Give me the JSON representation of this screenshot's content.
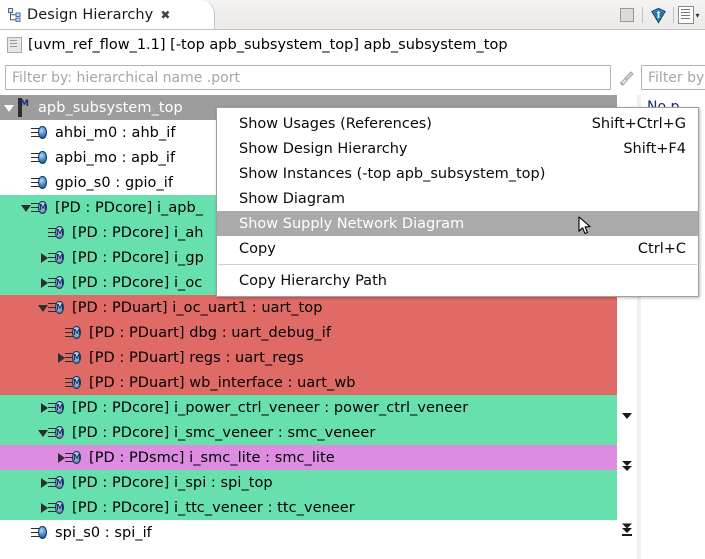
{
  "window": {
    "tab": {
      "label": "Design Hierarchy",
      "close": "✖",
      "icon": "hierarchy-icon"
    },
    "toolbar": [
      {
        "name": "minimize-button",
        "icon": "square-icon"
      },
      {
        "name": "debug-button",
        "icon": "bug-shield-icon"
      },
      {
        "name": "view-menu-button",
        "icon": "list-icon"
      }
    ],
    "view_menu_chevron": "▾"
  },
  "breadcrumb": {
    "icon": "design-icon",
    "text": "[uvm_ref_flow_1.1] [-top apb_subsystem_top] apb_subsystem_top"
  },
  "filter": {
    "placeholder": "Filter by: hierarchical name .port",
    "value": "",
    "clear_icon": "broom-icon",
    "secondary": {
      "placeholder": "Filter by",
      "value": ""
    }
  },
  "right_pane": {
    "text": "No p"
  },
  "nav_strip": [
    {
      "name": "scroll-down-button",
      "icon": "chevron-down-icon"
    },
    {
      "name": "scroll-page-down-button",
      "icon": "double-chevron-down-icon"
    },
    {
      "name": "scroll-to-end-button",
      "icon": "chevron-down-to-bar-icon"
    }
  ],
  "tree": {
    "rows": [
      {
        "indent": 0,
        "arrow": "open",
        "icon": "module-icon",
        "label": "apb_subsystem_top",
        "bg": "sel"
      },
      {
        "indent": 1,
        "arrow": "none",
        "icon": "interface-icon",
        "label": "ahbi_m0 : ahb_if",
        "bg": "white"
      },
      {
        "indent": 1,
        "arrow": "none",
        "icon": "interface-icon",
        "label": "apbi_mo : apb_if",
        "bg": "white"
      },
      {
        "indent": 1,
        "arrow": "none",
        "icon": "interface-icon",
        "label": "gpio_s0 : gpio_if",
        "bg": "white"
      },
      {
        "indent": 1,
        "arrow": "open",
        "icon": "pd-module-icon",
        "label": "[PD : PDcore] i_apb_",
        "bg": "green"
      },
      {
        "indent": 2,
        "arrow": "none",
        "icon": "pd-module-icon",
        "label": "[PD : PDcore] i_ah",
        "bg": "green"
      },
      {
        "indent": 2,
        "arrow": "closed",
        "icon": "pd-module-icon",
        "label": "[PD : PDcore] i_gp",
        "bg": "green"
      },
      {
        "indent": 2,
        "arrow": "closed",
        "icon": "pd-module-icon",
        "label": "[PD : PDcore] i_oc",
        "bg": "green"
      },
      {
        "indent": 2,
        "arrow": "open",
        "icon": "pd-module-icon",
        "label": "[PD : PDuart] i_oc_uart1 : uart_top",
        "bg": "red"
      },
      {
        "indent": 3,
        "arrow": "none",
        "icon": "pd-module-icon",
        "label": "[PD : PDuart] dbg : uart_debug_if",
        "bg": "red"
      },
      {
        "indent": 3,
        "arrow": "closed",
        "icon": "pd-module-icon",
        "label": "[PD : PDuart] regs : uart_regs",
        "bg": "red"
      },
      {
        "indent": 3,
        "arrow": "none",
        "icon": "pd-module-icon",
        "label": "[PD : PDuart] wb_interface : uart_wb",
        "bg": "red"
      },
      {
        "indent": 2,
        "arrow": "closed",
        "icon": "pd-module-icon",
        "label": "[PD : PDcore] i_power_ctrl_veneer : power_ctrl_veneer",
        "bg": "green"
      },
      {
        "indent": 2,
        "arrow": "open",
        "icon": "pd-module-icon",
        "label": "[PD : PDcore] i_smc_veneer : smc_veneer",
        "bg": "green"
      },
      {
        "indent": 3,
        "arrow": "closed",
        "icon": "pd-module-icon",
        "label": "[PD : PDsmc] i_smc_lite : smc_lite",
        "bg": "magenta"
      },
      {
        "indent": 2,
        "arrow": "closed",
        "icon": "pd-module-icon",
        "label": "[PD : PDcore] i_spi : spi_top",
        "bg": "green"
      },
      {
        "indent": 2,
        "arrow": "closed",
        "icon": "pd-module-icon",
        "label": "[PD : PDcore] i_ttc_veneer : ttc_veneer",
        "bg": "green"
      },
      {
        "indent": 1,
        "arrow": "none",
        "icon": "interface-icon",
        "label": "spi_s0 : spi_if",
        "bg": "white"
      }
    ]
  },
  "context_menu": {
    "items": [
      {
        "label": "Show Usages (References)",
        "accel": "Shift+Ctrl+G",
        "highlight": false,
        "separator_after": false
      },
      {
        "label": "Show Design Hierarchy",
        "accel": "Shift+F4",
        "highlight": false,
        "separator_after": false
      },
      {
        "label": "Show Instances (-top apb_subsystem_top)",
        "accel": "",
        "highlight": false,
        "separator_after": false
      },
      {
        "label": "Show Diagram",
        "accel": "",
        "highlight": false,
        "separator_after": false
      },
      {
        "label": "Show Supply Network Diagram",
        "accel": "",
        "highlight": true,
        "separator_after": false
      },
      {
        "label": "Copy",
        "accel": "Ctrl+C",
        "highlight": false,
        "separator_after": true
      },
      {
        "label": "Copy Hierarchy Path",
        "accel": "",
        "highlight": false,
        "separator_after": false
      }
    ]
  },
  "colors": {
    "power_domain_core": "#68e0ae",
    "power_domain_uart": "#e06a66",
    "power_domain_smc": "#dd8ce2",
    "selection": "#9d9d9d",
    "menu_highlight": "#aaaaaa"
  }
}
